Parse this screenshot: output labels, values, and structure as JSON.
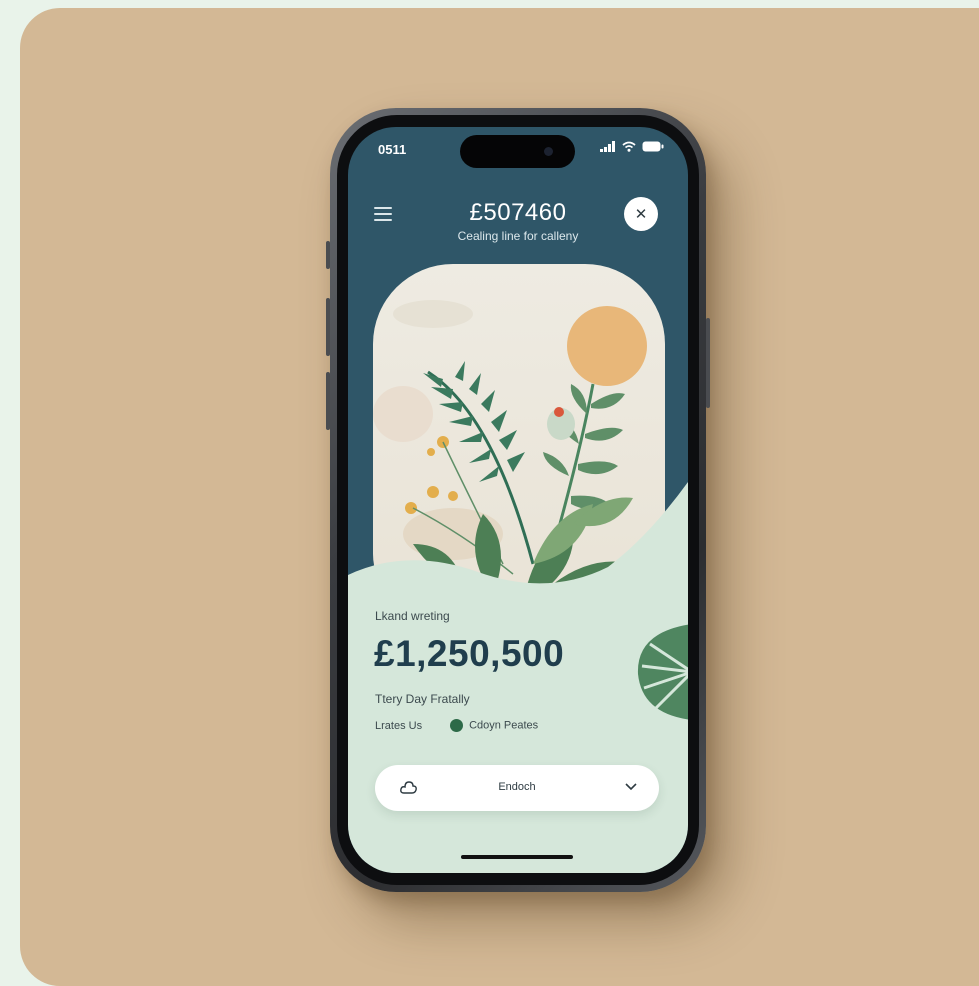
{
  "status_bar": {
    "time": "0511"
  },
  "header": {
    "amount": "£507460",
    "subtitle": "Cealing line for calleny"
  },
  "summary": {
    "label": "Lkand wreting",
    "amount": "£1,250,500",
    "day_label": "Ttery Day Fratally"
  },
  "legend": {
    "left_label": "Lrates Us",
    "right_label": "Cdoyn Peates"
  },
  "action_pill": {
    "label": "Endoch"
  },
  "colors": {
    "background_card": "#d3b895",
    "screen_teal": "#2f5668",
    "mint": "#d5e7da",
    "accent_green": "#2d6a48",
    "sun": "#e8b779"
  },
  "icons": [
    "menu-icon",
    "close-icon",
    "signal-icon",
    "wifi-icon",
    "battery-icon",
    "cloud-icon",
    "chevron-down-icon"
  ]
}
